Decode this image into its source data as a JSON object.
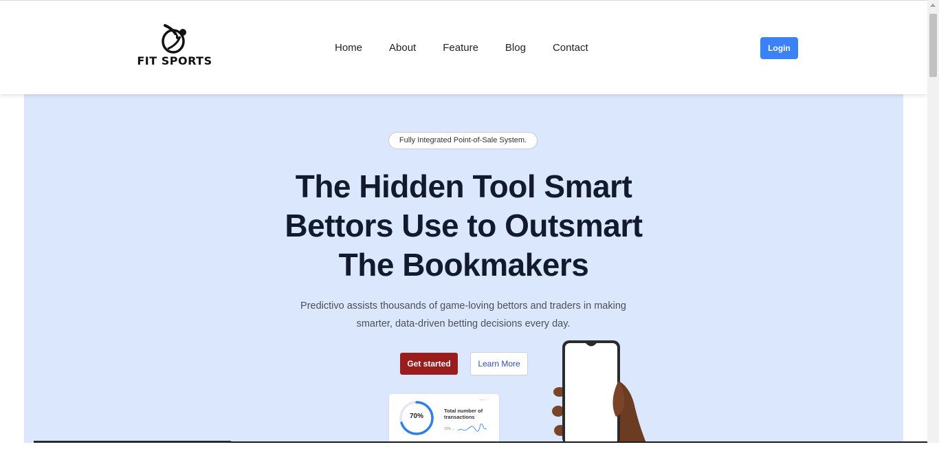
{
  "brand": {
    "logo_text": "FIT SPORTS",
    "logo_icon": "runner-swoosh-icon"
  },
  "nav": {
    "items": [
      {
        "label": "Home"
      },
      {
        "label": "About"
      },
      {
        "label": "Feature"
      },
      {
        "label": "Blog"
      },
      {
        "label": "Contact"
      }
    ]
  },
  "header": {
    "login_label": "Login"
  },
  "hero": {
    "badge": "Fully Integrated Point-of-Sale System.",
    "headline": "The Hidden Tool Smart Bettors Use to Outsmart The Bookmakers",
    "subtext": "Predictivo assists thousands of game-loving bettors and traders in making smarter, data-driven betting decisions every day.",
    "primary_cta": "Get started",
    "secondary_cta": "Learn More"
  },
  "stat_card": {
    "percent_label": "70%",
    "percent_value": 0.7,
    "label": "Total number of transactions",
    "small_text": "10% ⌄",
    "menu_icon": "more-horizontal-icon"
  },
  "colors": {
    "hero_background": "#dbe7fd",
    "login_button": "#3b82f6",
    "primary_button": "#9b1c1c",
    "headline": "#111a2e",
    "ring": "#2f7fe8"
  }
}
